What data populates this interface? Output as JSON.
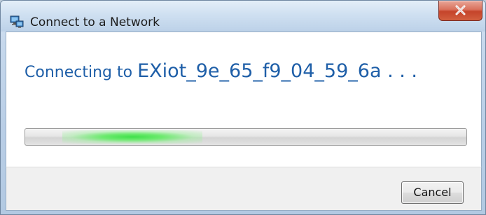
{
  "window": {
    "title": "Connect to a Network",
    "title_icon": "network-icon",
    "close_icon": "close-icon"
  },
  "status": {
    "prefix": "Connecting to ",
    "network_name": "EXiot_9e_65_f9_04_59_6a . . ."
  },
  "progress": {
    "mode": "indeterminate",
    "glow_position": 0.18,
    "glow_color": "#3fe04a"
  },
  "buttons": {
    "cancel_label": "Cancel"
  },
  "colors": {
    "status_text": "#1f5fa8",
    "close_button": "#c5442a",
    "titlebar": "#cfe0f1"
  }
}
